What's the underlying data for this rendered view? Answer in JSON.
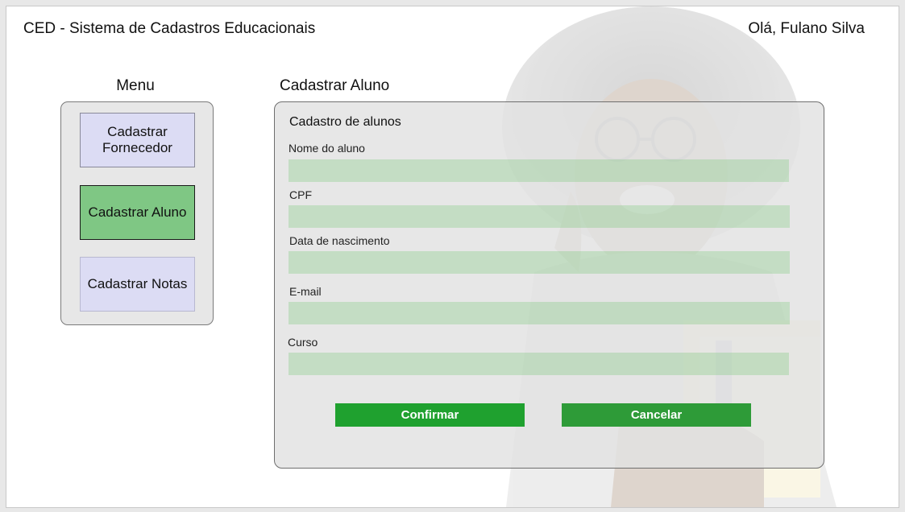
{
  "header": {
    "app_title": "CED - Sistema de Cadastros Educacionais",
    "greeting": "Olá, Fulano Silva"
  },
  "menu": {
    "heading": "Menu",
    "items": [
      {
        "label": "Cadastrar Fornecedor",
        "active": false
      },
      {
        "label": "Cadastrar Aluno",
        "active": true
      },
      {
        "label": "Cadastrar Notas",
        "active": false
      }
    ]
  },
  "page": {
    "heading": "Cadastrar Aluno"
  },
  "form": {
    "title": "Cadastro de alunos",
    "fields": [
      {
        "label": "Nome do aluno",
        "value": ""
      },
      {
        "label": "CPF",
        "value": ""
      },
      {
        "label": "Data de nascimento",
        "value": ""
      },
      {
        "label": "E-mail",
        "value": ""
      },
      {
        "label": "Curso",
        "value": ""
      }
    ],
    "confirm_label": "Confirmar",
    "cancel_label": "Cancelar"
  },
  "colors": {
    "active_menu": "#7fc784",
    "inactive_menu": "#dcdcf4",
    "button_green": "#1fa12f",
    "input_green": "#c8e6c9"
  },
  "background_image": "smiling-student-with-glasses-photo"
}
